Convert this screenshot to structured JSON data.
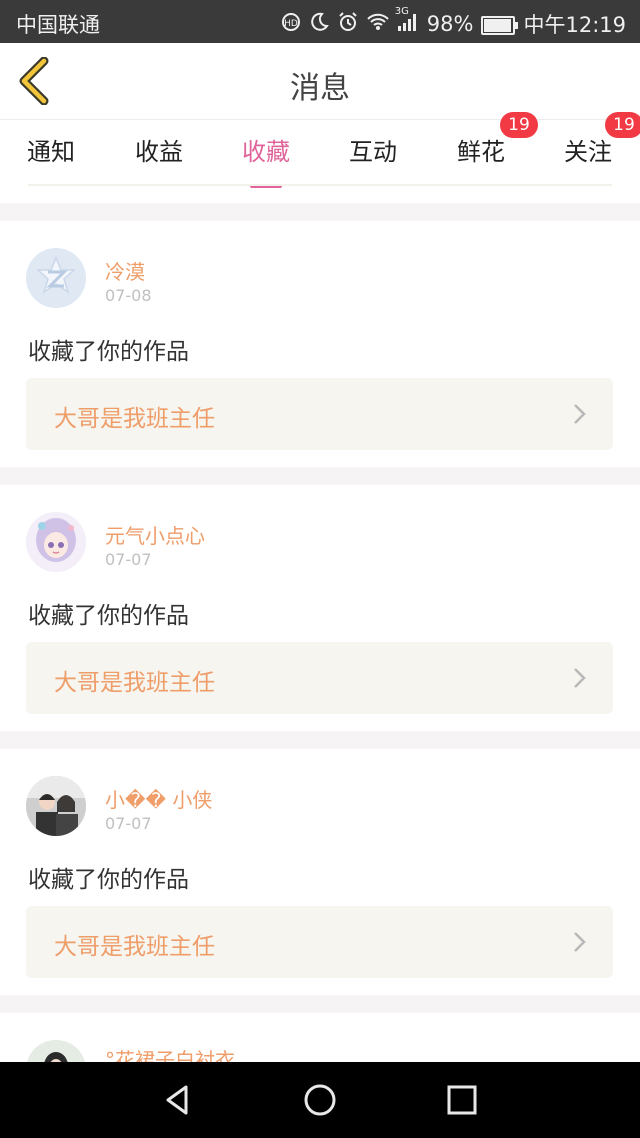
{
  "status_bar": {
    "carrier": "中国联通",
    "network": "3G",
    "battery": "98%",
    "battery_level": 0.98,
    "time": "中午12:19"
  },
  "header": {
    "title": "消息"
  },
  "tabs": [
    {
      "label": "通知",
      "badge": ""
    },
    {
      "label": "收益",
      "badge": ""
    },
    {
      "label": "收藏",
      "badge": "",
      "active": true
    },
    {
      "label": "互动",
      "badge": ""
    },
    {
      "label": "鲜花",
      "badge": "19"
    },
    {
      "label": "关注",
      "badge": "19"
    }
  ],
  "messages": [
    {
      "name": "冷漠",
      "date": "07-08",
      "action": "收藏了你的作品",
      "work": "大哥是我班主任",
      "avatar": "qq-default-avatar"
    },
    {
      "name": "元气小点心",
      "date": "07-07",
      "action": "收藏了你的作品",
      "work": "大哥是我班主任",
      "avatar": "anime-girl-avatar"
    },
    {
      "name": "小�� 小侠",
      "date": "07-07",
      "action": "收藏了你的作品",
      "work": "大哥是我班主任",
      "avatar": "couple-photo-avatar"
    },
    {
      "name": "°花裙子白衬衣",
      "avatar": "girl-photo-avatar"
    }
  ],
  "colors": {
    "accent_pink": "#e0649a",
    "name_orange": "#ef9d69",
    "badge_red": "#f23a44",
    "card_bg": "#f6f5ef"
  }
}
